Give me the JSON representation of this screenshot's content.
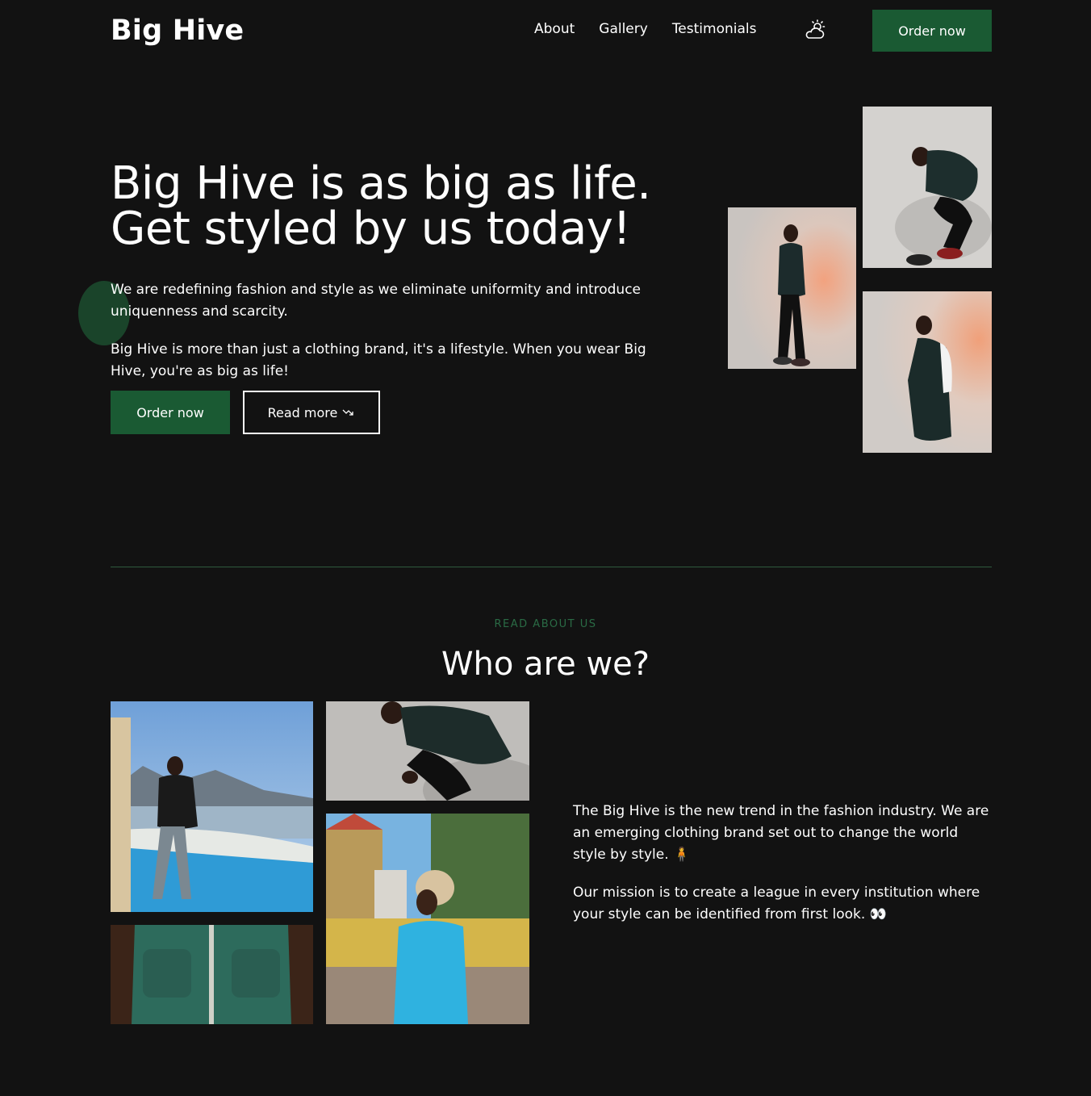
{
  "header": {
    "logo": "Big Hive",
    "nav": [
      "About",
      "Gallery",
      "Testimonials"
    ],
    "theme_icon": "cloud-sun-icon",
    "cta": "Order now"
  },
  "hero": {
    "title_line1": "Big Hive is as big as life.",
    "title_line2": "Get styled by us today!",
    "paragraph1": "We are redefining fashion and style as we eliminate uniformity and introduce uniquenness and scarcity.",
    "paragraph2": "Big Hive is more than just a clothing brand, it's a lifestyle. When you wear Big Hive, you're as big as life!",
    "primary_button": "Order now",
    "secondary_button": "Read more",
    "secondary_icon": "arrow-trend-down-icon"
  },
  "about": {
    "eyebrow": "READ ABOUT US",
    "title": "Who are we?",
    "paragraph1": "The Big Hive is the new trend in the fashion industry. We are an emerging clothing brand set out to change the world style by style. 🧍",
    "paragraph2": "Our mission is to create a league in every institution where your style can be identified from first look. 👀"
  },
  "colors": {
    "background": "#121212",
    "accent": "#1a5a33",
    "eyebrow": "#2a6b45"
  }
}
